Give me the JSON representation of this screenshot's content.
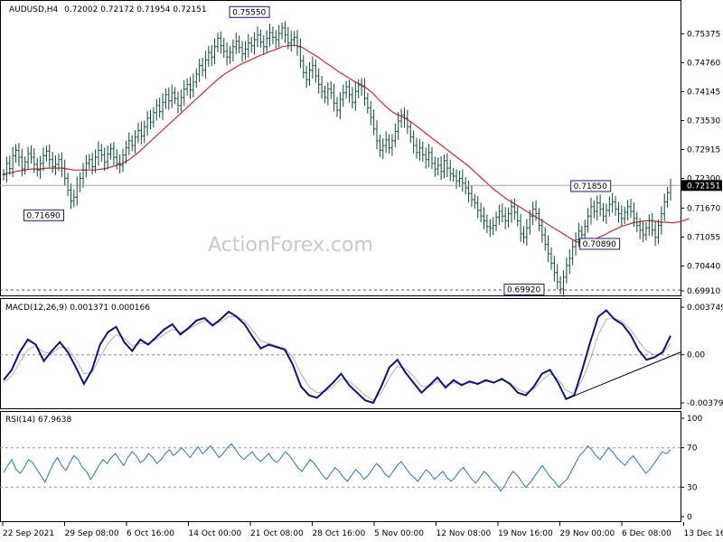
{
  "chart_data": [
    {
      "type": "candlestick",
      "instrument": "AUDUSD,H4",
      "ohlc_text": "0.72002 0.72172 0.71954 0.72151",
      "watermark": "ActionForex.com",
      "current_price": "0.72151",
      "y_ticks": [
        "0.75375",
        "0.74760",
        "0.74145",
        "0.73530",
        "0.72915",
        "0.72300",
        "0.71670",
        "0.71055",
        "0.70440",
        "0.69910"
      ],
      "ylim": [
        0.6991,
        0.7594
      ],
      "annotations": [
        {
          "text": "0.75550",
          "value": 0.7555
        },
        {
          "text": "0.71690",
          "value": 0.7169
        },
        {
          "text": "0.71850",
          "value": 0.7185
        },
        {
          "text": "0.70890",
          "value": 0.7089
        },
        {
          "text": "0.69920",
          "value": 0.6992
        }
      ],
      "close": [
        0.7238,
        0.7262,
        0.7251,
        0.7278,
        0.729,
        0.7275,
        0.725,
        0.7265,
        0.7283,
        0.7275,
        0.726,
        0.7248,
        0.7262,
        0.7278,
        0.7288,
        0.727,
        0.7255,
        0.726,
        0.727,
        0.7252,
        0.723,
        0.7205,
        0.7182,
        0.719,
        0.7215,
        0.723,
        0.7248,
        0.7262,
        0.727,
        0.7255,
        0.7275,
        0.729,
        0.728,
        0.7265,
        0.7282,
        0.7293,
        0.7275,
        0.7262,
        0.7258,
        0.728,
        0.7295,
        0.731,
        0.73,
        0.7318,
        0.7332,
        0.732,
        0.734,
        0.7358,
        0.735,
        0.737,
        0.7385,
        0.7372,
        0.7392,
        0.7408,
        0.7395,
        0.7412,
        0.74,
        0.7385,
        0.7402,
        0.742,
        0.743,
        0.7418,
        0.7435,
        0.7452,
        0.747,
        0.746,
        0.7482,
        0.7498,
        0.7488,
        0.751,
        0.7528,
        0.7512,
        0.75,
        0.7488,
        0.7498,
        0.751,
        0.7522,
        0.7508,
        0.7495,
        0.7505,
        0.7518,
        0.7512,
        0.7525,
        0.7535,
        0.752,
        0.751,
        0.7528,
        0.754,
        0.753,
        0.7525,
        0.7538,
        0.755,
        0.7535,
        0.7518,
        0.7525,
        0.753,
        0.751,
        0.748,
        0.7455,
        0.744,
        0.746,
        0.747,
        0.7448,
        0.743,
        0.7415,
        0.7402,
        0.742,
        0.7412,
        0.739,
        0.7375,
        0.7398,
        0.7412,
        0.7425,
        0.7408,
        0.7392,
        0.7415,
        0.7428,
        0.7425,
        0.74,
        0.738,
        0.736,
        0.7335,
        0.731,
        0.729,
        0.73,
        0.7312,
        0.7295,
        0.731,
        0.733,
        0.7352,
        0.7365,
        0.7358,
        0.734,
        0.7318,
        0.73,
        0.7285,
        0.7295,
        0.728,
        0.727,
        0.7285,
        0.7262,
        0.725,
        0.7258,
        0.7245,
        0.7268,
        0.7252,
        0.724,
        0.7235,
        0.7225,
        0.723,
        0.722,
        0.721,
        0.7198,
        0.7185,
        0.7178,
        0.7162,
        0.715,
        0.714,
        0.7128,
        0.7125,
        0.713,
        0.7148,
        0.716,
        0.715,
        0.714,
        0.7155,
        0.717,
        0.7158,
        0.714,
        0.7112,
        0.7105,
        0.7125,
        0.715,
        0.7165,
        0.7155,
        0.713,
        0.711,
        0.709,
        0.707,
        0.705,
        0.703,
        0.701,
        0.6995,
        0.702,
        0.7045,
        0.706,
        0.7085,
        0.71,
        0.7118,
        0.711,
        0.7128,
        0.715,
        0.717,
        0.716,
        0.7178,
        0.7165,
        0.715,
        0.7162,
        0.7175,
        0.718,
        0.7165,
        0.7155,
        0.7145,
        0.7158,
        0.717,
        0.716,
        0.7145,
        0.713,
        0.712,
        0.711,
        0.7125,
        0.714,
        0.712,
        0.7105,
        0.713,
        0.7155,
        0.718,
        0.72,
        0.7215
      ],
      "ma": [
        0.724,
        0.7241,
        0.7242,
        0.7243,
        0.7245,
        0.7246,
        0.7247,
        0.7248,
        0.7249,
        0.725,
        0.725,
        0.725,
        0.725,
        0.7251,
        0.7252,
        0.7252,
        0.7252,
        0.7252,
        0.7252,
        0.7252,
        0.7251,
        0.725,
        0.7249,
        0.7248,
        0.7248,
        0.7248,
        0.7248,
        0.7248,
        0.7248,
        0.7248,
        0.7248,
        0.7249,
        0.725,
        0.7251,
        0.7252,
        0.7254,
        0.7256,
        0.7258,
        0.726,
        0.7263,
        0.7266,
        0.727,
        0.7275,
        0.728,
        0.7285,
        0.7291,
        0.7297,
        0.7303,
        0.7309,
        0.7315,
        0.7321,
        0.7327,
        0.7333,
        0.7339,
        0.7345,
        0.7351,
        0.7357,
        0.7363,
        0.7369,
        0.7375,
        0.7381,
        0.7387,
        0.7393,
        0.7399,
        0.7405,
        0.7411,
        0.7417,
        0.7423,
        0.7429,
        0.7435,
        0.7441,
        0.7446,
        0.7451,
        0.7455,
        0.7459,
        0.7463,
        0.7467,
        0.7471,
        0.7474,
        0.7477,
        0.748,
        0.7483,
        0.7486,
        0.7489,
        0.7492,
        0.7494,
        0.7497,
        0.75,
        0.7502,
        0.7504,
        0.7507,
        0.751,
        0.7511,
        0.7512,
        0.7513,
        0.7513,
        0.7512,
        0.751,
        0.7507,
        0.7503,
        0.7499,
        0.7495,
        0.7491,
        0.7487,
        0.7482,
        0.7477,
        0.7473,
        0.7469,
        0.7464,
        0.7459,
        0.7455,
        0.7451,
        0.7447,
        0.7443,
        0.7439,
        0.7435,
        0.7432,
        0.7429,
        0.7425,
        0.742,
        0.7415,
        0.7409,
        0.7402,
        0.7395,
        0.7389,
        0.7383,
        0.7377,
        0.7372,
        0.7368,
        0.7365,
        0.7362,
        0.7359,
        0.7355,
        0.7351,
        0.7346,
        0.7341,
        0.7336,
        0.7331,
        0.7326,
        0.7321,
        0.7316,
        0.7311,
        0.7306,
        0.7301,
        0.7296,
        0.7291,
        0.7286,
        0.7281,
        0.7276,
        0.7271,
        0.7266,
        0.7261,
        0.7256,
        0.725,
        0.7244,
        0.7238,
        0.7232,
        0.7226,
        0.722,
        0.7214,
        0.7208,
        0.7203,
        0.7198,
        0.7193,
        0.7188,
        0.7184,
        0.718,
        0.7176,
        0.7172,
        0.7168,
        0.7164,
        0.716,
        0.7156,
        0.7152,
        0.7148,
        0.7144,
        0.714,
        0.7136,
        0.7132,
        0.7128,
        0.7124,
        0.712,
        0.7116,
        0.7112,
        0.7108,
        0.7104,
        0.71,
        0.7096,
        0.7094,
        0.7094,
        0.7095,
        0.7097,
        0.7099,
        0.7101,
        0.7103,
        0.7106,
        0.7109,
        0.7112,
        0.7116,
        0.7119,
        0.7122,
        0.7125,
        0.7128,
        0.713,
        0.7132,
        0.7134,
        0.7136,
        0.7137,
        0.7138,
        0.7139,
        0.714,
        0.714,
        0.714,
        0.7139,
        0.7138,
        0.7137,
        0.7137,
        0.7137,
        0.7136,
        0.7136,
        0.7137,
        0.7138,
        0.714,
        0.7142,
        0.7145
      ],
      "x_tick_labels": [
        "22 Sep 2021",
        "29 Sep 08:00",
        "6 Oct 16:00",
        "14 Oct 00:00",
        "21 Oct 08:00",
        "28 Oct 16:00",
        "5 Nov 00:00",
        "12 Nov 08:00",
        "19 Nov 16:00",
        "29 Nov 00:00",
        "6 Dec 08:00",
        "13 Dec 16:00"
      ],
      "colors": {
        "candle": "#0b4a3a",
        "ma": "#d62728",
        "price_line": "#a0a0a0",
        "label_border": "#1a1a8c"
      }
    },
    {
      "type": "line",
      "title": "MACD(12,26,9) 0.001371 0.000166",
      "y_ticks": [
        "0.003749",
        "0.00",
        "-0.003796"
      ],
      "ylim": [
        -0.0038,
        0.0039
      ],
      "series": [
        {
          "name": "MACD",
          "values": [
            -0.002,
            -0.0012,
            0.0002,
            0.0012,
            0.0008,
            -0.0005,
            0.0003,
            0.001,
            0.0002,
            -0.001,
            -0.0023,
            -0.0012,
            0.0008,
            0.0018,
            0.0022,
            0.001,
            0.0003,
            0.0012,
            0.0008,
            0.0014,
            0.002,
            0.0024,
            0.0016,
            0.0021,
            0.0027,
            0.0029,
            0.0023,
            0.0028,
            0.0034,
            0.003,
            0.0024,
            0.0014,
            0.0005,
            0.0008,
            0.0006,
            0.0004,
            -0.0008,
            -0.0025,
            -0.0032,
            -0.0034,
            -0.0028,
            -0.0022,
            -0.0015,
            -0.0024,
            -0.003,
            -0.0036,
            -0.0038,
            -0.0025,
            -0.001,
            -0.0004,
            -0.0014,
            -0.0022,
            -0.003,
            -0.0024,
            -0.0018,
            -0.0026,
            -0.002,
            -0.0024,
            -0.0021,
            -0.0023,
            -0.002,
            -0.0022,
            -0.0019,
            -0.0023,
            -0.003,
            -0.0032,
            -0.0025,
            -0.0015,
            -0.0012,
            -0.0022,
            -0.0035,
            -0.0032,
            -0.0012,
            0.001,
            0.003,
            0.0035,
            0.0028,
            0.0024,
            0.0016,
            0.0004,
            -0.0004,
            -0.0002,
            0.0002,
            0.0015
          ]
        },
        {
          "name": "Signal",
          "values": [
            -0.0022,
            -0.0017,
            -0.0006,
            0.0004,
            0.0007,
            0.0002,
            0.0001,
            0.0006,
            0.0005,
            -0.0004,
            -0.0015,
            -0.0014,
            -0.0002,
            0.0009,
            0.0016,
            0.0013,
            0.0007,
            0.0009,
            0.0009,
            0.0012,
            0.0016,
            0.002,
            0.0018,
            0.002,
            0.0024,
            0.0027,
            0.0024,
            0.0026,
            0.003,
            0.003,
            0.0027,
            0.0019,
            0.0011,
            0.0009,
            0.0007,
            0.0005,
            -0.0002,
            -0.0015,
            -0.0025,
            -0.003,
            -0.0029,
            -0.0025,
            -0.0019,
            -0.0021,
            -0.0026,
            -0.0032,
            -0.0036,
            -0.003,
            -0.0018,
            -0.0009,
            -0.0011,
            -0.0017,
            -0.0025,
            -0.0025,
            -0.0021,
            -0.0024,
            -0.0022,
            -0.0023,
            -0.0022,
            -0.0023,
            -0.0021,
            -0.0022,
            -0.002,
            -0.0022,
            -0.0027,
            -0.003,
            -0.0027,
            -0.002,
            -0.0015,
            -0.0019,
            -0.0028,
            -0.0031,
            -0.002,
            -0.0004,
            0.0016,
            0.0028,
            0.0029,
            0.0026,
            0.002,
            0.0011,
            0.0003,
            0.0,
            0.0001,
            0.0009
          ]
        }
      ],
      "colors": {
        "macd": "#0d1480",
        "signal": "#b0b0b0",
        "trendline": "#000000"
      }
    },
    {
      "type": "line",
      "title": "RSI(14) 67.9638",
      "y_ticks": [
        "100",
        "70",
        "30",
        "0"
      ],
      "ylim": [
        0,
        100
      ],
      "levels": [
        70,
        30
      ],
      "series": [
        {
          "name": "RSI",
          "values": [
            45,
            52,
            58,
            48,
            44,
            50,
            58,
            55,
            48,
            42,
            35,
            45,
            54,
            60,
            52,
            47,
            55,
            62,
            58,
            50,
            46,
            38,
            44,
            52,
            58,
            54,
            60,
            64,
            58,
            52,
            60,
            66,
            62,
            55,
            58,
            64,
            60,
            54,
            58,
            64,
            68,
            62,
            66,
            70,
            65,
            60,
            66,
            71,
            64,
            68,
            72,
            66,
            60,
            64,
            70,
            74,
            68,
            62,
            58,
            62,
            66,
            60,
            56,
            60,
            64,
            58,
            55,
            60,
            66,
            62,
            56,
            50,
            46,
            52,
            58,
            54,
            48,
            42,
            38,
            44,
            50,
            46,
            40,
            36,
            42,
            48,
            44,
            38,
            42,
            48,
            54,
            50,
            44,
            40,
            46,
            52,
            56,
            50,
            44,
            40,
            36,
            42,
            48,
            44,
            38,
            42,
            46,
            40,
            36,
            40,
            46,
            50,
            44,
            38,
            34,
            40,
            46,
            42,
            36,
            32,
            26,
            32,
            40,
            46,
            42,
            36,
            30,
            34,
            40,
            46,
            52,
            46,
            40,
            36,
            30,
            34,
            38,
            46,
            54,
            62,
            66,
            72,
            68,
            62,
            58,
            64,
            70,
            66,
            60,
            56,
            52,
            58,
            62,
            56,
            50,
            44,
            48,
            54,
            60,
            66,
            64,
            68
          ]
        }
      ],
      "colors": {
        "rsi": "#1e78c8",
        "levels": "#999999"
      }
    }
  ]
}
